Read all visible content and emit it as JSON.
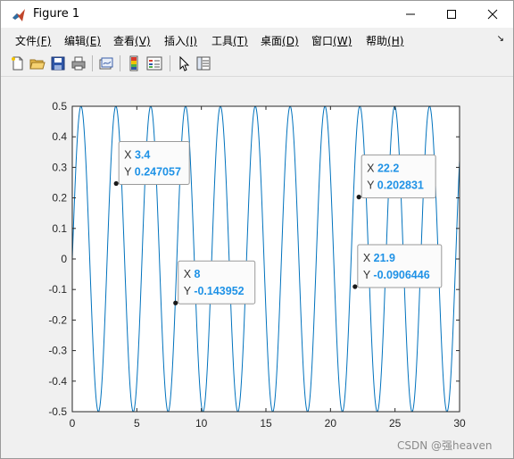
{
  "window": {
    "title": "Figure 1"
  },
  "menu": [
    {
      "label": "文件",
      "key": "(F)"
    },
    {
      "label": "编辑",
      "key": "(E)"
    },
    {
      "label": "查看",
      "key": "(V)"
    },
    {
      "label": "插入",
      "key": "(I)"
    },
    {
      "label": "工具",
      "key": "(T)"
    },
    {
      "label": "桌面",
      "key": "(D)"
    },
    {
      "label": "窗口",
      "key": "(W)"
    },
    {
      "label": "帮助",
      "key": "(H)"
    }
  ],
  "toolbar": {
    "icons": [
      "new-figure-icon",
      "open-file-icon",
      "save-icon",
      "print-icon",
      "link-plot-icon",
      "insert-colorbar-icon",
      "insert-legend-icon",
      "edit-plot-icon",
      "property-inspector-icon"
    ]
  },
  "colors": {
    "line": "#0072bd",
    "datatip_value": "#1f92e6"
  },
  "chart_data": {
    "type": "line",
    "xlim": [
      0,
      30
    ],
    "ylim": [
      -0.5,
      0.5
    ],
    "xticks": [
      "0",
      "5",
      "10",
      "15",
      "20",
      "25",
      "30"
    ],
    "yticks": [
      "-0.5",
      "-0.4",
      "-0.3",
      "-0.2",
      "-0.1",
      "0",
      "0.1",
      "0.2",
      "0.3",
      "0.4",
      "0.5"
    ],
    "grid": false,
    "series": [
      {
        "function": "y = 0.5*sin(2*pi*x/2.7)",
        "amplitude": 0.5,
        "period": 2.7,
        "x_range": [
          0,
          30
        ]
      }
    ],
    "datatips": [
      {
        "x_label": "3.4",
        "y_label": "0.247057",
        "x": 3.4,
        "y": 0.247057
      },
      {
        "x_label": "8",
        "y_label": "-0.143952",
        "x": 8,
        "y": -0.143952
      },
      {
        "x_label": "22.2",
        "y_label": "0.202831",
        "x": 22.2,
        "y": 0.202831
      },
      {
        "x_label": "21.9",
        "y_label": "-0.0906446",
        "x": 21.9,
        "y": -0.0906446
      }
    ]
  },
  "watermark": "CSDN @强heaven"
}
